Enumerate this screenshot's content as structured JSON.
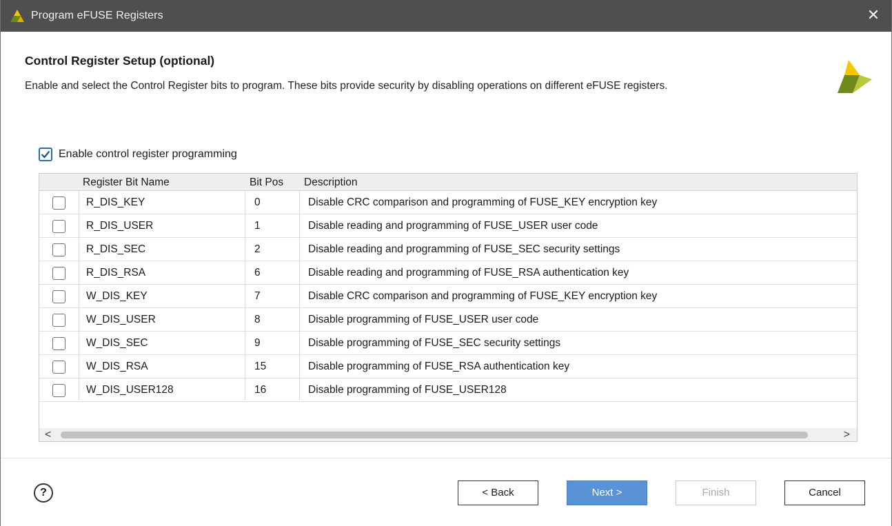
{
  "window": {
    "title": "Program eFUSE Registers",
    "close_glyph": "✕"
  },
  "header": {
    "title": "Control Register Setup (optional)",
    "description": "Enable and select the Control Register bits to program. These bits provide security by disabling operations on different eFUSE registers."
  },
  "enable_checkbox": {
    "label": "Enable control register programming",
    "checked": true
  },
  "table": {
    "columns": [
      "",
      "Register Bit Name",
      "Bit Pos",
      "Description"
    ],
    "rows": [
      {
        "checked": false,
        "name": "R_DIS_KEY",
        "bit_pos": "0",
        "description": "Disable CRC comparison and programming of FUSE_KEY encryption key"
      },
      {
        "checked": false,
        "name": "R_DIS_USER",
        "bit_pos": "1",
        "description": "Disable reading and programming of FUSE_USER user code"
      },
      {
        "checked": false,
        "name": "R_DIS_SEC",
        "bit_pos": "2",
        "description": "Disable reading and programming of FUSE_SEC security settings"
      },
      {
        "checked": false,
        "name": "R_DIS_RSA",
        "bit_pos": "6",
        "description": "Disable reading and programming of FUSE_RSA authentication key"
      },
      {
        "checked": false,
        "name": "W_DIS_KEY",
        "bit_pos": "7",
        "description": "Disable CRC comparison and programming of FUSE_KEY encryption key"
      },
      {
        "checked": false,
        "name": "W_DIS_USER",
        "bit_pos": "8",
        "description": "Disable programming of FUSE_USER user code"
      },
      {
        "checked": false,
        "name": "W_DIS_SEC",
        "bit_pos": "9",
        "description": "Disable programming of FUSE_SEC security settings"
      },
      {
        "checked": false,
        "name": "W_DIS_RSA",
        "bit_pos": "15",
        "description": "Disable programming of FUSE_RSA authentication key"
      },
      {
        "checked": false,
        "name": "W_DIS_USER128",
        "bit_pos": "16",
        "description": "Disable programming of FUSE_USER128"
      }
    ]
  },
  "scrollbar": {
    "left_glyph": "<",
    "right_glyph": ">"
  },
  "footer": {
    "help_glyph": "?",
    "buttons": {
      "back": "< Back",
      "next": "Next >",
      "finish": "Finish",
      "cancel": "Cancel"
    },
    "finish_enabled": false
  },
  "colors": {
    "titlebar": "#4f4f50",
    "accent": "#5a92d6",
    "logo_green": "#6d8a1b",
    "logo_yellow": "#f2c600"
  },
  "icons": [
    "app-logo-icon",
    "close-icon",
    "brand-logo-icon",
    "checkmark-icon",
    "help-icon",
    "scroll-left-icon",
    "scroll-right-icon"
  ]
}
